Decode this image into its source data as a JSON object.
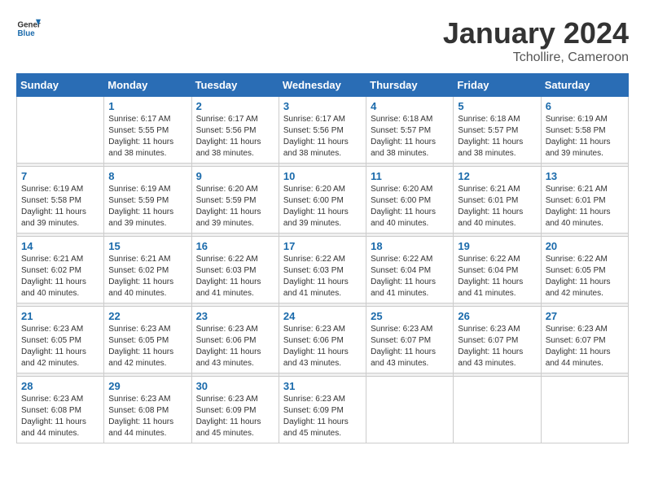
{
  "header": {
    "logo": {
      "general": "General",
      "blue": "Blue"
    },
    "title": "January 2024",
    "location": "Tchollire, Cameroon"
  },
  "weekdays": [
    "Sunday",
    "Monday",
    "Tuesday",
    "Wednesday",
    "Thursday",
    "Friday",
    "Saturday"
  ],
  "weeks": [
    [
      {
        "day": null,
        "info": null
      },
      {
        "day": "1",
        "sunrise": "6:17 AM",
        "sunset": "5:55 PM",
        "daylight": "11 hours and 38 minutes."
      },
      {
        "day": "2",
        "sunrise": "6:17 AM",
        "sunset": "5:56 PM",
        "daylight": "11 hours and 38 minutes."
      },
      {
        "day": "3",
        "sunrise": "6:17 AM",
        "sunset": "5:56 PM",
        "daylight": "11 hours and 38 minutes."
      },
      {
        "day": "4",
        "sunrise": "6:18 AM",
        "sunset": "5:57 PM",
        "daylight": "11 hours and 38 minutes."
      },
      {
        "day": "5",
        "sunrise": "6:18 AM",
        "sunset": "5:57 PM",
        "daylight": "11 hours and 38 minutes."
      },
      {
        "day": "6",
        "sunrise": "6:19 AM",
        "sunset": "5:58 PM",
        "daylight": "11 hours and 39 minutes."
      }
    ],
    [
      {
        "day": "7",
        "sunrise": "6:19 AM",
        "sunset": "5:58 PM",
        "daylight": "11 hours and 39 minutes."
      },
      {
        "day": "8",
        "sunrise": "6:19 AM",
        "sunset": "5:59 PM",
        "daylight": "11 hours and 39 minutes."
      },
      {
        "day": "9",
        "sunrise": "6:20 AM",
        "sunset": "5:59 PM",
        "daylight": "11 hours and 39 minutes."
      },
      {
        "day": "10",
        "sunrise": "6:20 AM",
        "sunset": "6:00 PM",
        "daylight": "11 hours and 39 minutes."
      },
      {
        "day": "11",
        "sunrise": "6:20 AM",
        "sunset": "6:00 PM",
        "daylight": "11 hours and 40 minutes."
      },
      {
        "day": "12",
        "sunrise": "6:21 AM",
        "sunset": "6:01 PM",
        "daylight": "11 hours and 40 minutes."
      },
      {
        "day": "13",
        "sunrise": "6:21 AM",
        "sunset": "6:01 PM",
        "daylight": "11 hours and 40 minutes."
      }
    ],
    [
      {
        "day": "14",
        "sunrise": "6:21 AM",
        "sunset": "6:02 PM",
        "daylight": "11 hours and 40 minutes."
      },
      {
        "day": "15",
        "sunrise": "6:21 AM",
        "sunset": "6:02 PM",
        "daylight": "11 hours and 40 minutes."
      },
      {
        "day": "16",
        "sunrise": "6:22 AM",
        "sunset": "6:03 PM",
        "daylight": "11 hours and 41 minutes."
      },
      {
        "day": "17",
        "sunrise": "6:22 AM",
        "sunset": "6:03 PM",
        "daylight": "11 hours and 41 minutes."
      },
      {
        "day": "18",
        "sunrise": "6:22 AM",
        "sunset": "6:04 PM",
        "daylight": "11 hours and 41 minutes."
      },
      {
        "day": "19",
        "sunrise": "6:22 AM",
        "sunset": "6:04 PM",
        "daylight": "11 hours and 41 minutes."
      },
      {
        "day": "20",
        "sunrise": "6:22 AM",
        "sunset": "6:05 PM",
        "daylight": "11 hours and 42 minutes."
      }
    ],
    [
      {
        "day": "21",
        "sunrise": "6:23 AM",
        "sunset": "6:05 PM",
        "daylight": "11 hours and 42 minutes."
      },
      {
        "day": "22",
        "sunrise": "6:23 AM",
        "sunset": "6:05 PM",
        "daylight": "11 hours and 42 minutes."
      },
      {
        "day": "23",
        "sunrise": "6:23 AM",
        "sunset": "6:06 PM",
        "daylight": "11 hours and 43 minutes."
      },
      {
        "day": "24",
        "sunrise": "6:23 AM",
        "sunset": "6:06 PM",
        "daylight": "11 hours and 43 minutes."
      },
      {
        "day": "25",
        "sunrise": "6:23 AM",
        "sunset": "6:07 PM",
        "daylight": "11 hours and 43 minutes."
      },
      {
        "day": "26",
        "sunrise": "6:23 AM",
        "sunset": "6:07 PM",
        "daylight": "11 hours and 43 minutes."
      },
      {
        "day": "27",
        "sunrise": "6:23 AM",
        "sunset": "6:07 PM",
        "daylight": "11 hours and 44 minutes."
      }
    ],
    [
      {
        "day": "28",
        "sunrise": "6:23 AM",
        "sunset": "6:08 PM",
        "daylight": "11 hours and 44 minutes."
      },
      {
        "day": "29",
        "sunrise": "6:23 AM",
        "sunset": "6:08 PM",
        "daylight": "11 hours and 44 minutes."
      },
      {
        "day": "30",
        "sunrise": "6:23 AM",
        "sunset": "6:09 PM",
        "daylight": "11 hours and 45 minutes."
      },
      {
        "day": "31",
        "sunrise": "6:23 AM",
        "sunset": "6:09 PM",
        "daylight": "11 hours and 45 minutes."
      },
      {
        "day": null,
        "info": null
      },
      {
        "day": null,
        "info": null
      },
      {
        "day": null,
        "info": null
      }
    ]
  ],
  "labels": {
    "sunrise": "Sunrise:",
    "sunset": "Sunset:",
    "daylight": "Daylight:"
  }
}
